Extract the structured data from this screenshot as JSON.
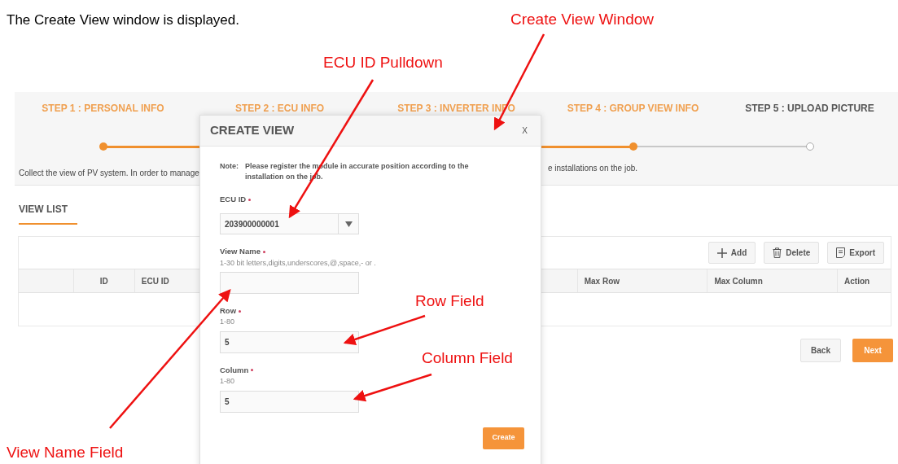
{
  "intro": "The Create View window is displayed.",
  "steps": [
    {
      "label": "STEP 1 : PERSONAL INFO",
      "completed": true
    },
    {
      "label": "STEP 2 : ECU INFO",
      "completed": true
    },
    {
      "label": "STEP 3 : INVERTER INFO",
      "completed": true
    },
    {
      "label": "STEP 4 : GROUP VIEW INFO",
      "completed": true
    },
    {
      "label": "STEP 5 : UPLOAD PICTURE",
      "completed": false
    }
  ],
  "progress": {
    "level": 0.75
  },
  "description": [
    "Collect the view of PV system. In order to manage",
    "e installations on the job."
  ],
  "tabs": [
    {
      "label": "VIEW LIST",
      "selected": true
    }
  ],
  "toolbar": [
    {
      "kind": "add",
      "label": "Add"
    },
    {
      "kind": "delete",
      "label": "Delete"
    },
    {
      "kind": "export",
      "label": "Export"
    }
  ],
  "table": {
    "columns": [
      "",
      "ID",
      "ECU ID",
      "Max Row",
      "Max Column",
      "Action"
    ]
  },
  "footer_buttons": [
    {
      "label": "Back",
      "primary": false
    },
    {
      "label": "Next",
      "primary": true
    }
  ],
  "modal": {
    "title": "CREATE VIEW",
    "close": "X",
    "note_label": "Note:",
    "note": "Please register the module in accurate position according to the installation on the job.",
    "fields": [
      {
        "kind": "select",
        "label": "ECU ID",
        "required": true,
        "value": "203900000001"
      },
      {
        "kind": "text",
        "label": "View Name",
        "required": true,
        "hint": "1-30 bit letters,digits,underscores,@,space,- or ."
      },
      {
        "kind": "text",
        "label": "Row",
        "required": true,
        "hint": "1-80",
        "value": "5"
      },
      {
        "kind": "text",
        "label": "Column",
        "required": true,
        "hint": "1-80",
        "value": "5"
      }
    ],
    "submit": "Create"
  },
  "annotations": [
    {
      "text": "Create View Window"
    },
    {
      "text": "ECU ID Pulldown"
    },
    {
      "text": "Row Field"
    },
    {
      "text": "Column Field"
    },
    {
      "text": "View Name Field"
    }
  ]
}
